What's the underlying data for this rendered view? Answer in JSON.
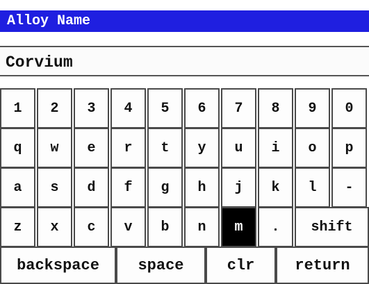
{
  "dialog": {
    "title": "Alloy Name"
  },
  "input": {
    "value": "Corvium"
  },
  "keyboard": {
    "rows": [
      [
        "1",
        "2",
        "3",
        "4",
        "5",
        "6",
        "7",
        "8",
        "9",
        "0"
      ],
      [
        "q",
        "w",
        "e",
        "r",
        "t",
        "y",
        "u",
        "i",
        "o",
        "p"
      ],
      [
        "a",
        "s",
        "d",
        "f",
        "g",
        "h",
        "j",
        "k",
        "l",
        "-"
      ],
      [
        "z",
        "x",
        "c",
        "v",
        "b",
        "n",
        "m",
        ".",
        "shift"
      ]
    ],
    "bottom": [
      "backspace",
      "space",
      "clr",
      "return"
    ],
    "selected_key": "m"
  },
  "colors": {
    "titlebar": "#1f1fe0",
    "selected_key_bg": "#000000"
  }
}
